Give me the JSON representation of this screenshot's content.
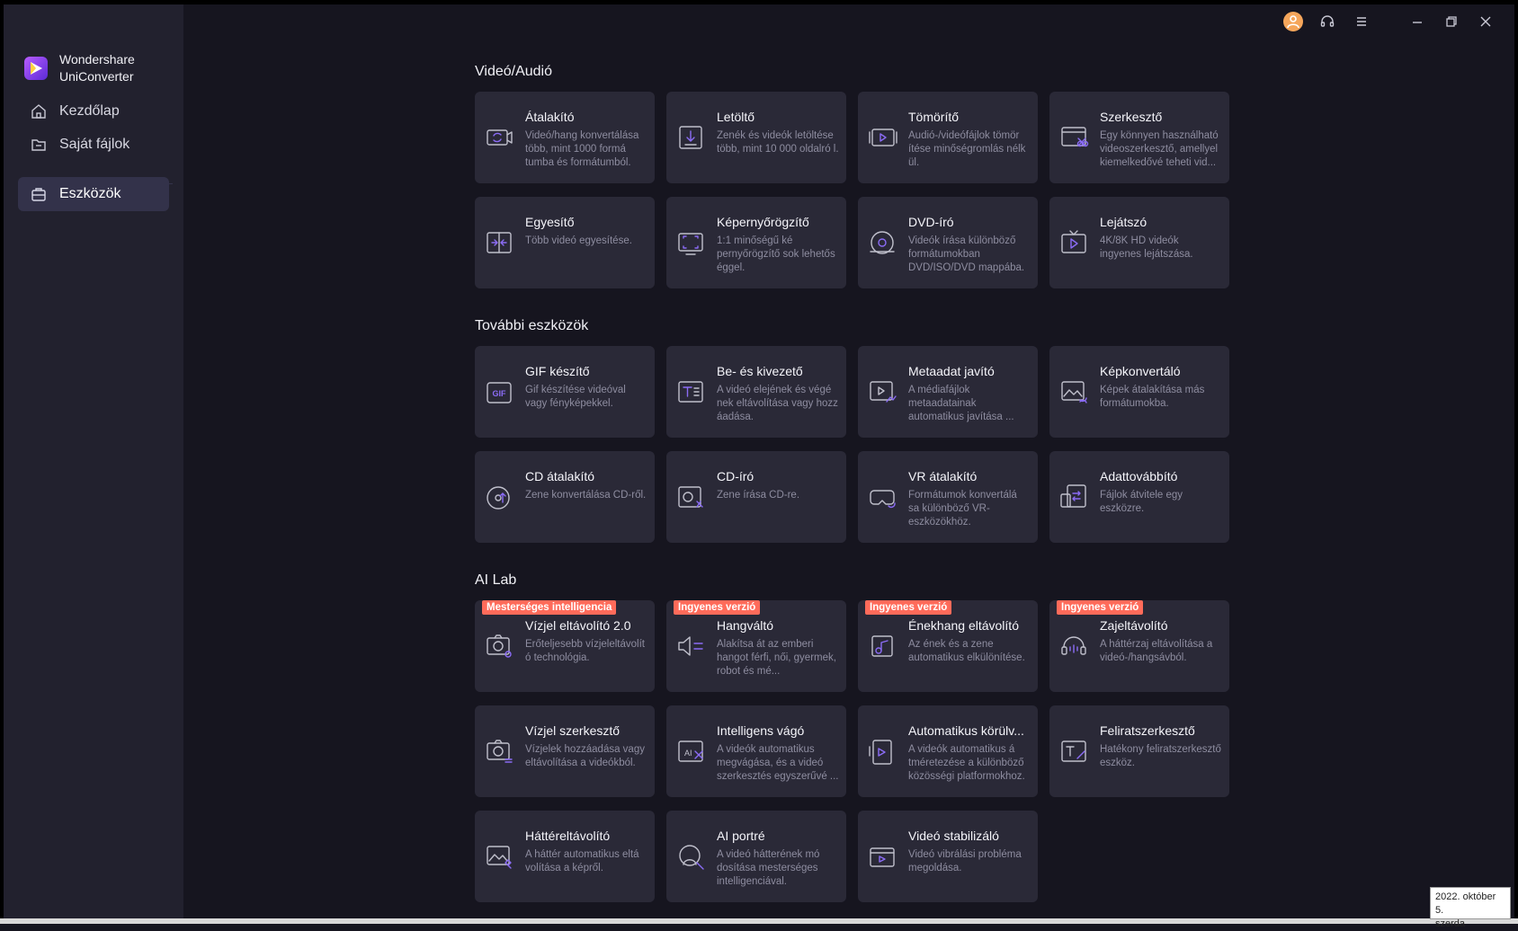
{
  "app": {
    "brand_line1": "Wondershare",
    "brand_line2": "UniConverter",
    "accent": "#8b5cf6"
  },
  "nav": [
    {
      "label": "Kezdőlap",
      "icon": "home-icon"
    },
    {
      "label": "Saját fájlok",
      "icon": "folder-icon"
    },
    {
      "label": "Eszközök",
      "icon": "toolbox-icon",
      "active": true
    }
  ],
  "sections": [
    {
      "title": "Videó/Audió",
      "cards": [
        {
          "title": "Átalakító",
          "desc": "Videó/hang konvertálása több, mint 1000 formá tumba és formátumból.",
          "icon": "convert-icon"
        },
        {
          "title": "Letöltő",
          "desc": "Zenék és videók letöltése több, mint 10 000 oldalró l.",
          "icon": "download-icon"
        },
        {
          "title": "Tömörítő",
          "desc": "Audió-/videófájlok tömör ítése minőségromlás nélk ül.",
          "icon": "compress-icon"
        },
        {
          "title": "Szerkesztő",
          "desc": "Egy könnyen használható videoszerkesztő, amellyel kiemelkedővé teheti vid...",
          "icon": "editor-icon"
        },
        {
          "title": "Egyesítő",
          "desc": "Több videó egyesítése.",
          "icon": "merge-icon"
        },
        {
          "title": "Képernyőrögzítő",
          "desc": "1:1 minőségű ké pernyőrögzítő sok lehetős éggel.",
          "icon": "screen-record-icon"
        },
        {
          "title": "DVD-író",
          "desc": "Videók írása különböző formátumokban DVD/ISO/DVD mappába.",
          "icon": "dvd-icon"
        },
        {
          "title": "Lejátszó",
          "desc": "4K/8K HD videók ingyenes lejátszása.",
          "icon": "player-icon"
        }
      ]
    },
    {
      "title": "További eszközök",
      "cards": [
        {
          "title": "GIF készítő",
          "desc": "Gif készítése videóval vagy fényképekkel.",
          "icon": "gif-icon"
        },
        {
          "title": "Be- és kivezető",
          "desc": "A videó elejének és végé nek eltávolítása vagy hozz áadása.",
          "icon": "intro-outro-icon"
        },
        {
          "title": "Metaadat javító",
          "desc": "A médiafájlok metaadatainak automatikus javítása ...",
          "icon": "metadata-icon"
        },
        {
          "title": "Képkonvertáló",
          "desc": "Képek átalakítása más formátumokba.",
          "icon": "image-convert-icon"
        },
        {
          "title": "CD átalakító",
          "desc": "Zene konvertálása CD-ről.",
          "icon": "cd-convert-icon"
        },
        {
          "title": "CD-író",
          "desc": "Zene írása CD-re.",
          "icon": "cd-burn-icon"
        },
        {
          "title": "VR átalakító",
          "desc": "Formátumok konvertálá sa különböző VR-eszközökhöz.",
          "icon": "vr-icon"
        },
        {
          "title": "Adattovábbító",
          "desc": "Fájlok átvitele egy eszközre.",
          "icon": "transfer-icon"
        }
      ]
    },
    {
      "title": "AI Lab",
      "cards": [
        {
          "title": "Vízjel eltávolító 2.0",
          "desc": "Erőteljesebb vízjeleltávolít ó technológia.",
          "icon": "watermark-remove-icon",
          "badge": "Mesterséges intelligencia"
        },
        {
          "title": "Hangváltó",
          "desc": "Alakítsa át az emberi hangot férfi, női, gyermek, robot és mé...",
          "icon": "voice-change-icon",
          "badge": "Ingyenes verzió"
        },
        {
          "title": "Énekhang eltávolító",
          "desc": "Az ének és a zene automatikus elkülönítése.",
          "icon": "vocal-remove-icon",
          "badge": "Ingyenes verzió"
        },
        {
          "title": "Zajeltávolító",
          "desc": "A háttérzaj eltávolítása a videó-/hangsávból.",
          "icon": "noise-remove-icon",
          "badge": "Ingyenes verzió"
        },
        {
          "title": "Vízjel szerkesztő",
          "desc": "Vízjelek hozzáadása vagy eltávolítása a videókból.",
          "icon": "watermark-edit-icon"
        },
        {
          "title": "Intelligens vágó",
          "desc": "A videók automatikus megvágása, és a videó szerkesztés egyszerűvé ...",
          "icon": "smart-trim-icon"
        },
        {
          "title": "Automatikus körülv...",
          "desc": "A videók automatikus á tméretezése a különböző közösségi platformokhoz.",
          "icon": "auto-reframe-icon"
        },
        {
          "title": "Feliratszerkesztő",
          "desc": "Hatékony feliratszerkesztő eszköz.",
          "icon": "subtitle-icon"
        },
        {
          "title": "Háttéreltávolító",
          "desc": "A háttér automatikus eltá volítása a képről.",
          "icon": "bg-remove-icon"
        },
        {
          "title": "AI portré",
          "desc": "A videó hátterének mó dosítása mesterséges intelligenciával.",
          "icon": "ai-portrait-icon"
        },
        {
          "title": "Videó stabilizáló",
          "desc": "Videó vibrálási probléma megoldása.",
          "icon": "stabilize-icon"
        }
      ]
    }
  ],
  "taskbar": {
    "date": "2022. október 5.",
    "weekday": "szerda"
  }
}
